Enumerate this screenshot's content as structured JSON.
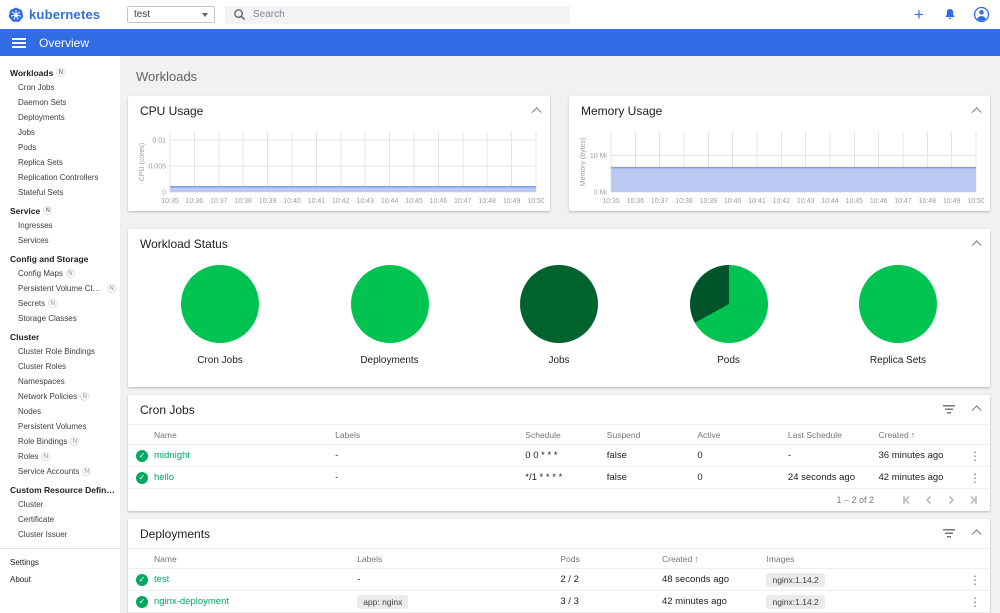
{
  "header": {
    "brand": "kubernetes",
    "namespace_select": {
      "value": "test"
    },
    "search": {
      "placeholder": "Search"
    }
  },
  "toolbar": {
    "title": "Overview"
  },
  "icons": {
    "plus": "+",
    "check": "✓",
    "kebab": "⋮",
    "sort_asc": "↑"
  },
  "colors": {
    "brand_blue": "#326ce5",
    "link_green": "#00a862",
    "pie_green": "#00c351",
    "pie_dark_green": "#00542a",
    "chart_line_blue": "#7f9cf0",
    "chart_fill_blue": "#bcc9f2"
  },
  "sidebar": {
    "entries": [
      {
        "type": "group",
        "label": "Workloads",
        "badge": "N"
      },
      {
        "type": "item",
        "label": "Cron Jobs"
      },
      {
        "type": "item",
        "label": "Daemon Sets"
      },
      {
        "type": "item",
        "label": "Deployments"
      },
      {
        "type": "item",
        "label": "Jobs"
      },
      {
        "type": "item",
        "label": "Pods"
      },
      {
        "type": "item",
        "label": "Replica Sets"
      },
      {
        "type": "item",
        "label": "Replication Controllers"
      },
      {
        "type": "item",
        "label": "Stateful Sets"
      },
      {
        "type": "group",
        "label": "Service",
        "badge": "N"
      },
      {
        "type": "item",
        "label": "Ingresses"
      },
      {
        "type": "item",
        "label": "Services"
      },
      {
        "type": "group",
        "label": "Config and Storage"
      },
      {
        "type": "item",
        "label": "Config Maps",
        "badge": "N"
      },
      {
        "type": "item",
        "label": "Persistent Volume Claims",
        "badge": "N"
      },
      {
        "type": "item",
        "label": "Secrets",
        "badge": "N"
      },
      {
        "type": "item",
        "label": "Storage Classes"
      },
      {
        "type": "group",
        "label": "Cluster"
      },
      {
        "type": "item",
        "label": "Cluster Role Bindings"
      },
      {
        "type": "item",
        "label": "Cluster Roles"
      },
      {
        "type": "item",
        "label": "Namespaces"
      },
      {
        "type": "item",
        "label": "Network Policies",
        "badge": "N"
      },
      {
        "type": "item",
        "label": "Nodes"
      },
      {
        "type": "item",
        "label": "Persistent Volumes"
      },
      {
        "type": "item",
        "label": "Role Bindings",
        "badge": "N"
      },
      {
        "type": "item",
        "label": "Roles",
        "badge": "N"
      },
      {
        "type": "item",
        "label": "Service Accounts",
        "badge": "N"
      },
      {
        "type": "group",
        "label": "Custom Resource Definitions"
      },
      {
        "type": "item",
        "label": "Cluster"
      },
      {
        "type": "item",
        "label": "Certificate"
      },
      {
        "type": "item",
        "label": "Cluster Issuer"
      }
    ],
    "footer_items": [
      {
        "type": "root",
        "label": "Settings"
      },
      {
        "type": "root",
        "label": "About"
      }
    ]
  },
  "page": {
    "title": "Workloads"
  },
  "chart_data": [
    {
      "type": "area",
      "title": "CPU Usage",
      "ylabel": "CPU (cores)",
      "x": [
        "10:35",
        "10:36",
        "10:37",
        "10:38",
        "10:39",
        "10:40",
        "10:41",
        "10:42",
        "10:43",
        "10:44",
        "10:45",
        "10:46",
        "10:47",
        "10:48",
        "10:49",
        "10:50"
      ],
      "values": [
        0.001,
        0.001,
        0.001,
        0.001,
        0.001,
        0.001,
        0.001,
        0.001,
        0.001,
        0.001,
        0.001,
        0.001,
        0.001,
        0.001,
        0.001,
        0.001
      ],
      "yticks": [
        "0",
        "0.005",
        "0.01"
      ],
      "ytick_values": [
        0,
        0.005,
        0.01
      ],
      "ylim": [
        0,
        0.0115
      ],
      "grid": true,
      "line_color": "#7f9cf0",
      "fill_color": "#bcc9f2"
    },
    {
      "type": "area",
      "title": "Memory Usage",
      "ylabel": "Memory (bytes)",
      "x": [
        "10:35",
        "10:36",
        "10:37",
        "10:38",
        "10:39",
        "10:40",
        "10:41",
        "10:42",
        "10:43",
        "10:44",
        "10:45",
        "10:46",
        "10:47",
        "10:48",
        "10:49",
        "10:50"
      ],
      "values": [
        6.7,
        6.7,
        6.7,
        6.7,
        6.7,
        6.7,
        6.7,
        6.7,
        6.7,
        6.7,
        6.7,
        6.7,
        6.7,
        6.7,
        6.7,
        6.7
      ],
      "yticks": [
        "0 Mi",
        "10 Mi"
      ],
      "ytick_values": [
        0,
        10
      ],
      "ylim": [
        0,
        16.5
      ],
      "grid": true,
      "unit": "Mi",
      "line_color": "#7f9cf0",
      "fill_color": "#bcc9f2"
    }
  ],
  "workload_status": {
    "title": "Workload Status",
    "charts": [
      {
        "label": "Cron Jobs",
        "segments": [
          {
            "color": "#00c351",
            "pct": 100
          }
        ]
      },
      {
        "label": "Deployments",
        "segments": [
          {
            "color": "#00c351",
            "pct": 100
          }
        ]
      },
      {
        "label": "Jobs",
        "segments": [
          {
            "color": "#00632d",
            "pct": 100
          }
        ]
      },
      {
        "label": "Pods",
        "segments": [
          {
            "color": "#00c351",
            "pct": 67
          },
          {
            "color": "#00542a",
            "pct": 33
          }
        ]
      },
      {
        "label": "Replica Sets",
        "segments": [
          {
            "color": "#00c351",
            "pct": 100
          }
        ]
      }
    ]
  },
  "cron_jobs": {
    "title": "Cron Jobs",
    "columns": [
      "Name",
      "Labels",
      "Schedule",
      "Suspend",
      "Active",
      "Last Schedule",
      "Created"
    ],
    "sort": {
      "column": "Created",
      "direction": "asc"
    },
    "rows": [
      {
        "name": "midnight",
        "labels": "-",
        "schedule": "0 0 * * *",
        "suspend": "false",
        "active": "0",
        "last_schedule": "-",
        "created": "36 minutes ago"
      },
      {
        "name": "hello",
        "labels": "-",
        "schedule": "*/1 * * * *",
        "suspend": "false",
        "active": "0",
        "last_schedule": "24 seconds ago",
        "created": "42 minutes ago"
      }
    ],
    "pagination": {
      "range_label": "1 – 2 of 2"
    }
  },
  "deployments": {
    "title": "Deployments",
    "columns": [
      "Name",
      "Labels",
      "Pods",
      "Created",
      "Images"
    ],
    "sort": {
      "column": "Created",
      "direction": "asc"
    },
    "rows": [
      {
        "name": "test",
        "labels": "-",
        "pods": "2 / 2",
        "created": "48 seconds ago",
        "images": "nginx:1.14.2"
      },
      {
        "name": "nginx-deployment",
        "labels": "app: nginx",
        "pods": "3 / 3",
        "created": "42 minutes ago",
        "images": "nginx:1.14.2"
      }
    ]
  }
}
